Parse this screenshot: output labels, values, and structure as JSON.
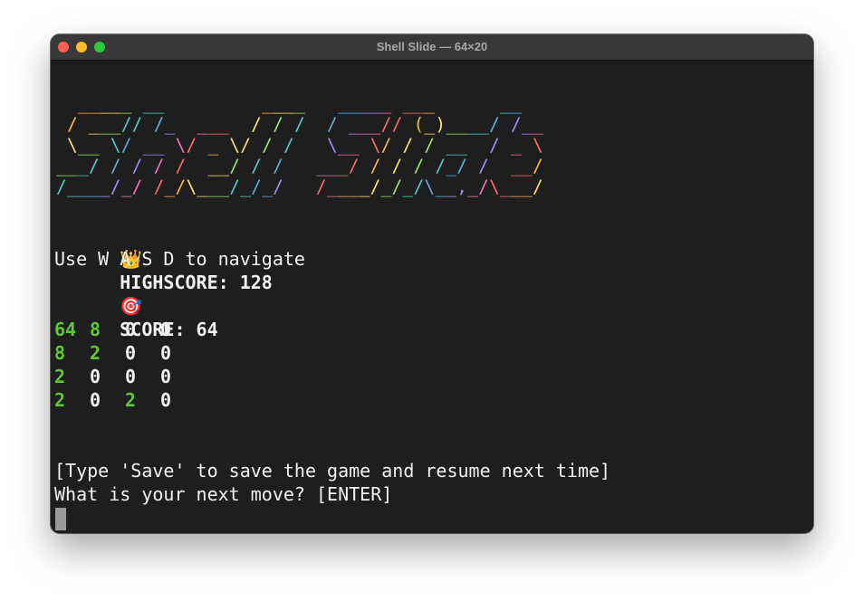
{
  "window": {
    "title": "Shell Slide — 64×20"
  },
  "banner": {
    "lines": [
      "  _____ __         ____   _____ ___      __  ",
      " / ___// /_  ___  / / /  / ___// (_)____/ /__",
      " \\__ \\/ __ \\/ _ \\/ / /   \\__ \\/ / / __  / _ \\",
      "___/ / / / /  __/ / /   ___/ / / / /_/ /  __/",
      "/____/_/ /_/\\___/_/_/   /____/_/_/\\__,_/\\___/ "
    ],
    "palette": [
      "#ff6b6b",
      "#ffb347",
      "#ffe066",
      "#9be564",
      "#4ecdc4",
      "#5dade2",
      "#a78bfa",
      "#f472b6"
    ]
  },
  "score": {
    "highscore_icon": "crown-icon",
    "highscore_emoji": "👑",
    "highscore_label": "HIGHSCORE: 128",
    "score_icon": "dart-icon",
    "score_emoji": "🎯",
    "score_label": "SCORE: 64"
  },
  "instructions": "Use W A S D to navigate",
  "board": [
    [
      "64",
      "8",
      "0",
      "0"
    ],
    [
      "8",
      "2",
      "0",
      "0"
    ],
    [
      "2",
      "0",
      "0",
      "0"
    ],
    [
      "2",
      "0",
      "2",
      "0"
    ]
  ],
  "prompt": {
    "save_hint": "[Type 'Save' to save the game and resume next time]",
    "question": "What is your next move? [ENTER]",
    "input_value": ""
  },
  "colors": {
    "terminal_bg": "#1e1e1e",
    "text": "#f2f2f2",
    "tile_nonzero": "#5ec934",
    "cursor": "#9a9a9a"
  }
}
